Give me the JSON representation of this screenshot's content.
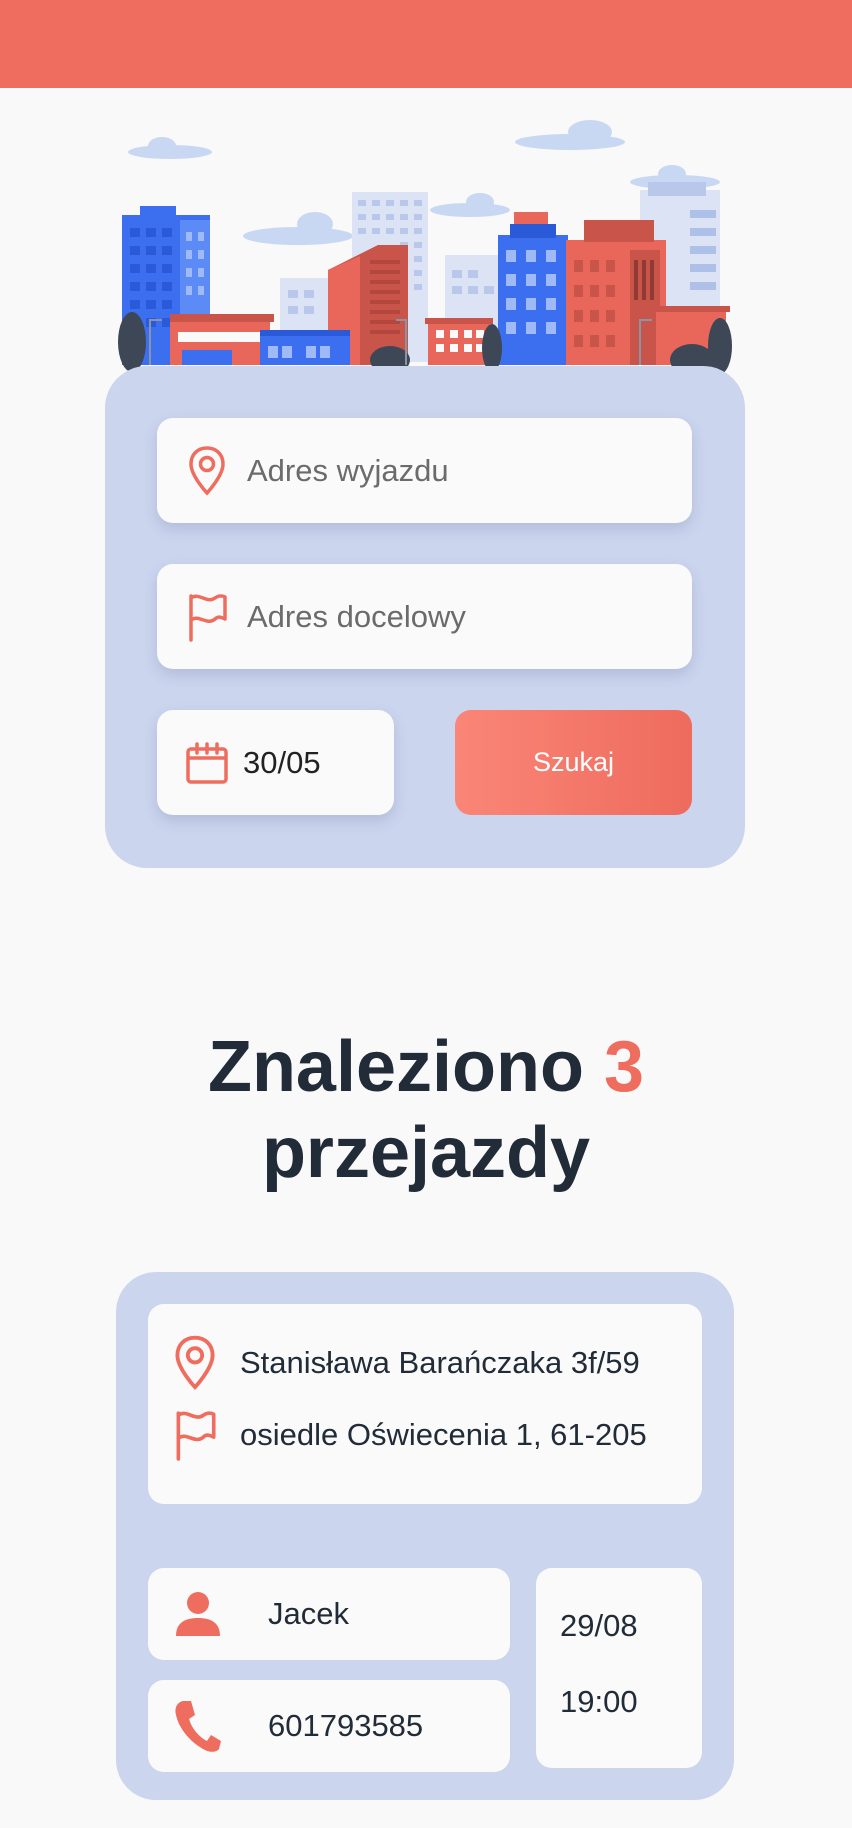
{
  "colors": {
    "accent": "#ef6d5e",
    "card_bg": "#cbd5ee",
    "field_bg": "#fafafa",
    "text_dark": "#212c38",
    "building_blue": "#3b6ff0",
    "building_red": "#e8675a"
  },
  "header": {},
  "illustration": {
    "name": "city-skyline"
  },
  "search": {
    "from_placeholder": "Adres wyjazdu",
    "to_placeholder": "Adres docelowy",
    "date_value": "30/05",
    "submit_label": "Szukaj",
    "icons": {
      "from": "map-pin-icon",
      "to": "flag-icon",
      "date": "calendar-icon"
    }
  },
  "results": {
    "title_prefix": "Znaleziono",
    "count": "3",
    "title_suffix": "przejazdy"
  },
  "rides": [
    {
      "from": "Stanisława Barańczaka 3f/59",
      "to": "osiedle Oświecenia 1, 61-205",
      "driver": "Jacek",
      "phone": "601793585",
      "date": "29/08",
      "time": "19:00",
      "icons": {
        "from": "map-pin-icon",
        "to": "flag-icon",
        "driver": "user-icon",
        "phone": "phone-icon"
      }
    }
  ]
}
